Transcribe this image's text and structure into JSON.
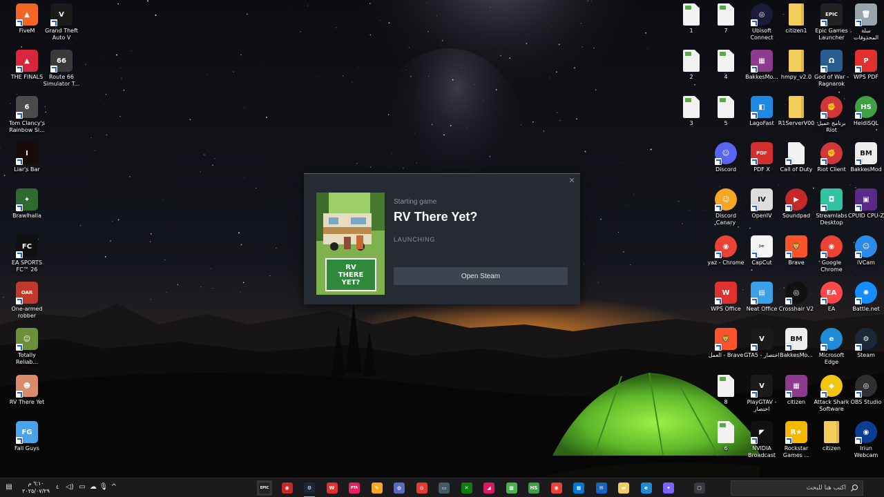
{
  "colors": {
    "dialog_bg": "#262a33",
    "dialog_border": "#3c6e97",
    "button_bg": "#3d4450",
    "taskbar_bg": "#1b1b1e",
    "tent_green": "#7fe23a",
    "sunset_orange": "#e0701c"
  },
  "dialog": {
    "status": "Starting game",
    "title": "RV There Yet?",
    "state": "LAUNCHING",
    "button_label": "Open Steam",
    "close_icon": "close-icon",
    "cover_text": "RV\nTHERE\nYET?"
  },
  "desktop_left": [
    {
      "label": "FiveM",
      "icon": "fivem-icon",
      "color": "#f26522",
      "glyph": "▲"
    },
    {
      "label": "Grand Theft\nAuto V",
      "icon": "gta-v-icon",
      "color": "#1a1a1a",
      "glyph": "V"
    },
    {
      "label": "THE FINALS",
      "icon": "the-finals-icon",
      "color": "#d7263d",
      "glyph": "▲"
    },
    {
      "label": "Route 66\nSimulator T...",
      "icon": "route66-icon",
      "color": "#3a3a3a",
      "glyph": "66"
    },
    {
      "label": "Tom Clancy's\nRainbow Si...",
      "icon": "rainbow-six-icon",
      "color": "#4b4b4b",
      "glyph": "6"
    },
    {
      "label": "Liar's Bar",
      "icon": "liars-bar-icon",
      "color": "#1a0a0a",
      "glyph": "I"
    },
    {
      "label": "Brawlhalla",
      "icon": "brawlhalla-icon",
      "color": "#2e6b2e",
      "glyph": "✦"
    },
    {
      "label": "EA SPORTS\nFC™ 26",
      "icon": "ea-fc-icon",
      "color": "#111111",
      "glyph": "FC"
    },
    {
      "label": "One-armed\nrobber",
      "icon": "one-armed-robber-icon",
      "color": "#c0392b",
      "glyph": "OAR"
    },
    {
      "label": "Totally\nReliab...",
      "icon": "totally-reliable-icon",
      "color": "#6d8f3a",
      "glyph": "☺"
    },
    {
      "label": "RV There Yet",
      "icon": "rv-there-yet-icon",
      "color": "#d98b6a",
      "glyph": "☻"
    },
    {
      "label": "Fall Guys",
      "icon": "fall-guys-icon",
      "color": "#4aa3e8",
      "glyph": "FG"
    }
  ],
  "desktop_right": [
    {
      "label": "1",
      "icon": "png-file-icon",
      "kind": "doc"
    },
    {
      "label": "7",
      "icon": "png-file-icon",
      "kind": "doc"
    },
    {
      "label": "Ubisoft\nConnect",
      "icon": "ubisoft-icon",
      "color": "#1b1b3a",
      "glyph": "◎",
      "round": true
    },
    {
      "label": "citizen1",
      "icon": "folder-icon",
      "kind": "folder"
    },
    {
      "label": "Epic Games\nLauncher",
      "icon": "epic-games-icon",
      "color": "#222222",
      "glyph": "EPIC"
    },
    {
      "label": "سلة\nالمحذوفات",
      "icon": "recycle-bin-icon",
      "color": "#9aa4ad",
      "glyph": "🗑"
    },
    {
      "label": "2",
      "icon": "png-file-icon",
      "kind": "doc"
    },
    {
      "label": "4",
      "icon": "png-file-icon",
      "kind": "doc"
    },
    {
      "label": "BakkesMo...",
      "icon": "winrar-icon",
      "color": "#8e3a8e",
      "glyph": "▦"
    },
    {
      "label": "hmpy_v2.0",
      "icon": "folder-icon",
      "kind": "folder"
    },
    {
      "label": "God of War -\nRagnarok",
      "icon": "god-of-war-icon",
      "color": "#2a5d8f",
      "glyph": "Ω"
    },
    {
      "label": "WPS PDF",
      "icon": "wps-pdf-icon",
      "color": "#e0312e",
      "glyph": "P"
    },
    {
      "label": "3",
      "icon": "png-file-icon",
      "kind": "doc"
    },
    {
      "label": "5",
      "icon": "png-file-icon",
      "kind": "doc"
    },
    {
      "label": "LagoFast",
      "icon": "lagofast-icon",
      "color": "#1e88e5",
      "glyph": "◧"
    },
    {
      "label": "R1ServerV00",
      "icon": "folder-icon",
      "kind": "folder"
    },
    {
      "label": "برنامج عميل\nRiot",
      "icon": "riot-client-icon",
      "color": "#d13639",
      "glyph": "✊",
      "round": true
    },
    {
      "label": "HeidiSQL",
      "icon": "heidisql-icon",
      "color": "#3fa142",
      "glyph": "HS",
      "round": true
    },
    {
      "label": "Discord",
      "icon": "discord-icon",
      "color": "#5865f2",
      "glyph": "☺",
      "round": true
    },
    {
      "label": "PDF X",
      "icon": "pdf-x-icon",
      "color": "#d32f2f",
      "glyph": "PDF"
    },
    {
      "label": "Call of Duty",
      "icon": "blank-file-icon",
      "kind": "blank"
    },
    {
      "label": "Riot Client",
      "icon": "riot-client-icon",
      "color": "#d13639",
      "glyph": "✊",
      "round": true
    },
    {
      "label": "BakkesMod",
      "icon": "bakkesmod-icon",
      "color": "#eeeeee",
      "glyph": "BM",
      "dark": true
    },
    {
      "label": "Discord\nCanary",
      "icon": "discord-canary-icon",
      "color": "#f6a623",
      "glyph": "☺",
      "round": true
    },
    {
      "label": "OpenIV",
      "icon": "openiv-icon",
      "color": "#dddddd",
      "glyph": "IV",
      "dark": true
    },
    {
      "label": "Soundpad",
      "icon": "soundpad-icon",
      "color": "#c62828",
      "glyph": "▶",
      "round": true
    },
    {
      "label": "Streamlabs\nDesktop",
      "icon": "streamlabs-icon",
      "color": "#31c3a2",
      "glyph": "◘"
    },
    {
      "label": "CPUID CPU-Z",
      "icon": "cpuz-icon",
      "color": "#5b2a86",
      "glyph": "▣"
    },
    {
      "label": "yaz - Chrome",
      "icon": "chrome-icon",
      "color": "#ea4335",
      "glyph": "◉",
      "round": true
    },
    {
      "label": "CapCut",
      "icon": "capcut-icon",
      "color": "#f5f5f5",
      "glyph": "✂",
      "dark": true
    },
    {
      "label": "Brave",
      "icon": "brave-icon",
      "color": "#fb542b",
      "glyph": "🦁"
    },
    {
      "label": "Google\nChrome",
      "icon": "chrome-icon",
      "color": "#ea4335",
      "glyph": "◉",
      "round": true
    },
    {
      "label": "iVCam",
      "icon": "ivcam-icon",
      "color": "#2c8ae8",
      "glyph": "☺",
      "round": true
    },
    {
      "label": "WPS Office",
      "icon": "wps-office-icon",
      "color": "#e0312e",
      "glyph": "W"
    },
    {
      "label": "Neat Office",
      "icon": "neat-office-icon",
      "color": "#3aa0e8",
      "glyph": "▤"
    },
    {
      "label": "Crosshair V2",
      "icon": "crosshair-icon",
      "color": "#111111",
      "glyph": "◎",
      "round": true
    },
    {
      "label": "EA",
      "icon": "ea-icon",
      "color": "#ff4747",
      "glyph": "EA",
      "round": true
    },
    {
      "label": "Battle.net",
      "icon": "battlenet-icon",
      "color": "#148eff",
      "glyph": "✺",
      "round": true
    },
    {
      "label": "العمل - Brave",
      "icon": "brave-icon",
      "color": "#fb542b",
      "glyph": "🦁"
    },
    {
      "label": "GTA5 - اختصار",
      "icon": "gta-v-icon",
      "color": "#1a1a1a",
      "glyph": "V"
    },
    {
      "label": "BakkesMo...",
      "icon": "bakkesmod-icon",
      "color": "#eeeeee",
      "glyph": "BM",
      "dark": true
    },
    {
      "label": "Microsoft\nEdge",
      "icon": "edge-icon",
      "color": "#1f8ad6",
      "glyph": "e",
      "round": true
    },
    {
      "label": "Steam",
      "icon": "steam-icon",
      "color": "#1b2838",
      "glyph": "⚙",
      "round": true
    },
    {
      "label": "8",
      "icon": "png-file-icon",
      "kind": "doc"
    },
    {
      "label": "PlayGTAV -\nاختصار",
      "icon": "gta-v-icon",
      "color": "#1a1a1a",
      "glyph": "V"
    },
    {
      "label": "citizen",
      "icon": "winrar-icon",
      "color": "#8e3a8e",
      "glyph": "▦"
    },
    {
      "label": "Attack Shark\nSoftware",
      "icon": "attack-shark-icon",
      "color": "#f1c40f",
      "glyph": "◆",
      "round": true
    },
    {
      "label": "OBS Studio",
      "icon": "obs-icon",
      "color": "#302e31",
      "glyph": "◎",
      "round": true
    },
    {
      "label": "6",
      "icon": "png-file-icon",
      "kind": "doc"
    },
    {
      "label": "NVIDIA\nBroadcast",
      "icon": "nvidia-broadcast-icon",
      "color": "#111111",
      "glyph": "◤"
    },
    {
      "label": "Rockstar\nGames ...",
      "icon": "rockstar-icon",
      "color": "#f5b800",
      "glyph": "R★"
    },
    {
      "label": "citizen",
      "icon": "folder-icon",
      "kind": "folder"
    },
    {
      "label": "Iriun\nWebcam",
      "icon": "iriun-icon",
      "color": "#0b3d91",
      "glyph": "◉",
      "round": true
    }
  ],
  "taskbar": {
    "search_placeholder": "اكتب هنا للبحث",
    "search_icon": "search-icon",
    "clock_time": "٦:١٠ م",
    "clock_date": "٢٠٢٥/٠٧/٢٩",
    "notification_count": "٤",
    "tray_icons": [
      "notification-icon",
      "volume-icon",
      "network-icon",
      "onedrive-icon",
      "microphone-icon",
      "chevron-up-icon"
    ],
    "apps": [
      {
        "name": "epic-games-icon",
        "color": "#222222",
        "glyph": "EPIC",
        "hl": true
      },
      {
        "name": "recorder-icon",
        "color": "#c62828",
        "glyph": "◉"
      },
      {
        "name": "steam-icon",
        "color": "#1b2838",
        "glyph": "⚙",
        "active": true
      },
      {
        "name": "wps-icon",
        "color": "#e0312e",
        "glyph": "W"
      },
      {
        "name": "app-pink-icon",
        "color": "#e91e63",
        "glyph": "PTA"
      },
      {
        "name": "app-yellow-icon",
        "color": "#f9a825",
        "glyph": "✎"
      },
      {
        "name": "app-purple-icon",
        "color": "#5c6bc0",
        "glyph": "◍"
      },
      {
        "name": "app-red-icon",
        "color": "#e53935",
        "glyph": "◎"
      },
      {
        "name": "window-icon",
        "color": "#455a64",
        "glyph": "▭"
      },
      {
        "name": "xbox-icon",
        "color": "#107c10",
        "glyph": "✕"
      },
      {
        "name": "app-pink2-icon",
        "color": "#d81b60",
        "glyph": "◢"
      },
      {
        "name": "minecraft-icon",
        "color": "#4caf50",
        "glyph": "▩"
      },
      {
        "name": "heidisql-icon",
        "color": "#3fa142",
        "glyph": "HS"
      },
      {
        "name": "chrome-icon",
        "color": "#ea4335",
        "glyph": "◉"
      },
      {
        "name": "store-icon",
        "color": "#0078d4",
        "glyph": "▦"
      },
      {
        "name": "mail-icon",
        "color": "#1565c0",
        "glyph": "✉"
      },
      {
        "name": "file-explorer-icon",
        "color": "#f3cd5b",
        "glyph": "▬"
      },
      {
        "name": "edge-icon",
        "color": "#1f8ad6",
        "glyph": "e"
      },
      {
        "name": "copilot-icon",
        "color": "#7b61ff",
        "glyph": "✦"
      },
      {
        "name": "task-view-icon",
        "color": "#3a3a3e",
        "glyph": "▢"
      }
    ]
  }
}
